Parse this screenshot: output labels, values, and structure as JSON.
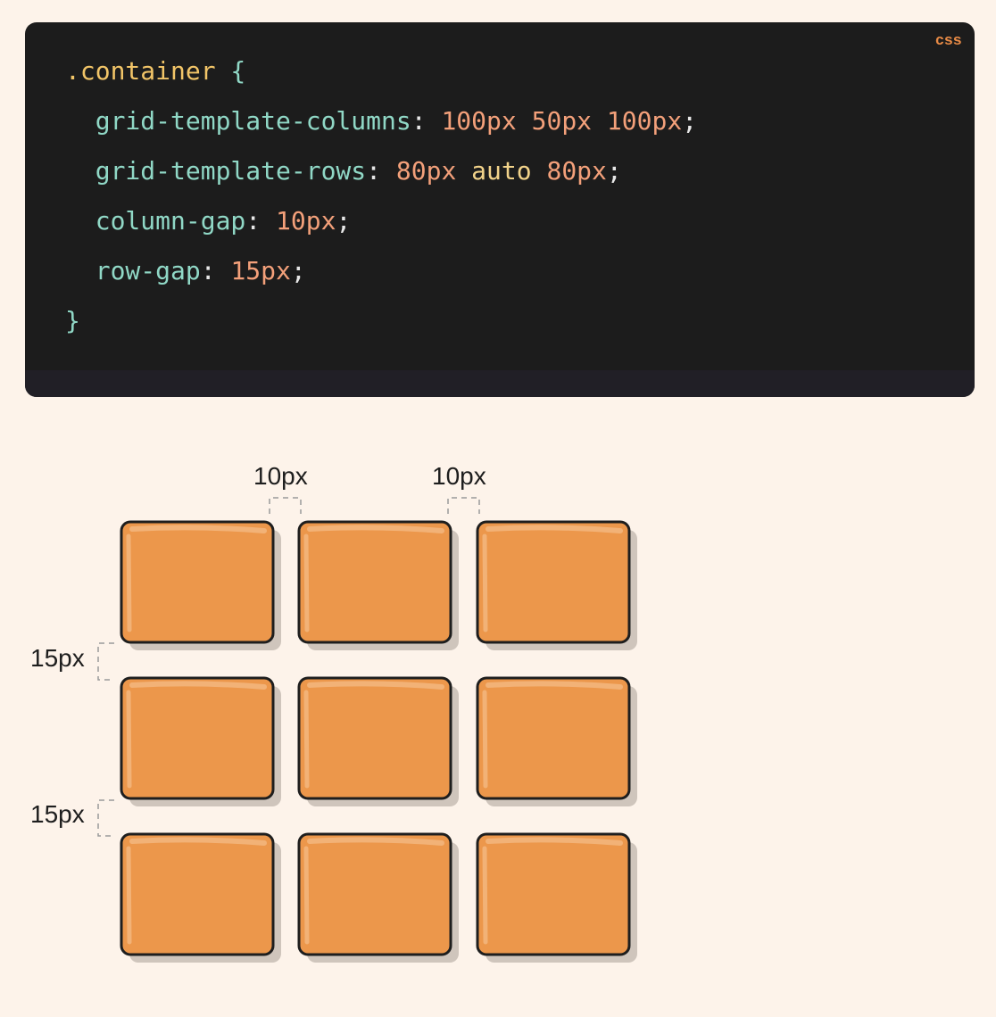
{
  "code_block": {
    "language": "css",
    "lines": [
      [
        {
          "t": ".container",
          "c": "sel"
        },
        {
          "t": " {",
          "c": "brace"
        }
      ],
      [
        {
          "t": "  grid-template-columns",
          "c": "prop"
        },
        {
          "t": ": ",
          "c": "punc"
        },
        {
          "t": "100px",
          "c": "num"
        },
        {
          "t": " ",
          "c": "punc"
        },
        {
          "t": "50px",
          "c": "num"
        },
        {
          "t": " ",
          "c": "punc"
        },
        {
          "t": "100px",
          "c": "num"
        },
        {
          "t": ";",
          "c": "punc"
        }
      ],
      [
        {
          "t": "  grid-template-rows",
          "c": "prop"
        },
        {
          "t": ": ",
          "c": "punc"
        },
        {
          "t": "80px",
          "c": "num"
        },
        {
          "t": " ",
          "c": "punc"
        },
        {
          "t": "auto",
          "c": "kw"
        },
        {
          "t": " ",
          "c": "punc"
        },
        {
          "t": "80px",
          "c": "num"
        },
        {
          "t": ";",
          "c": "punc"
        }
      ],
      [
        {
          "t": "  column-gap",
          "c": "prop"
        },
        {
          "t": ": ",
          "c": "punc"
        },
        {
          "t": "10px",
          "c": "num"
        },
        {
          "t": ";",
          "c": "punc"
        }
      ],
      [
        {
          "t": "  row-gap",
          "c": "prop"
        },
        {
          "t": ": ",
          "c": "punc"
        },
        {
          "t": "15px",
          "c": "num"
        },
        {
          "t": ";",
          "c": "punc"
        }
      ],
      [
        {
          "t": "}",
          "c": "brace"
        }
      ]
    ]
  },
  "diagram": {
    "column_gap_labels": [
      "10px",
      "10px"
    ],
    "row_gap_labels": [
      "15px",
      "15px"
    ],
    "rows": 3,
    "columns": 3,
    "colors": {
      "cell_fill": "#ec974b",
      "cell_highlight": "#f2b277",
      "cell_outline": "#1e1e1e",
      "cell_shadow": "#cfc5bc",
      "gap_marker": "#9a9a9a"
    }
  }
}
